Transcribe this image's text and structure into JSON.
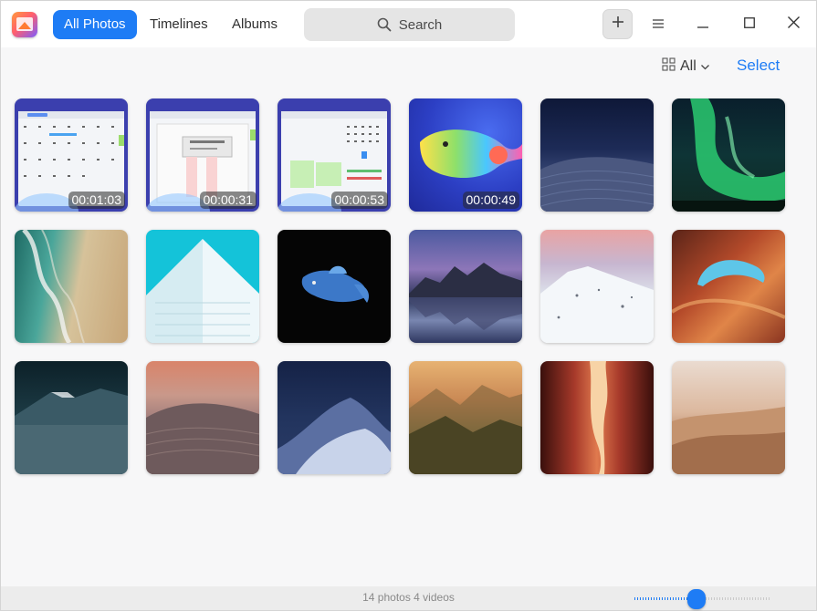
{
  "nav": {
    "tabs": [
      {
        "label": "All Photos",
        "active": true
      },
      {
        "label": "Timelines",
        "active": false
      },
      {
        "label": "Albums",
        "active": false
      }
    ]
  },
  "search": {
    "placeholder": "Search"
  },
  "toolbar": {
    "filter_label": "All",
    "select_label": "Select"
  },
  "photos": [
    {
      "kind": "video",
      "duration": "00:01:03",
      "subject": "calendar-month-screenshot"
    },
    {
      "kind": "video",
      "duration": "00:00:31",
      "subject": "calendar-dialog-screenshot"
    },
    {
      "kind": "video",
      "duration": "00:00:53",
      "subject": "calendar-day-screenshot"
    },
    {
      "kind": "video",
      "duration": "00:00:49",
      "subject": "rainbow-whale"
    },
    {
      "kind": "photo",
      "subject": "desert-dunes-night"
    },
    {
      "kind": "photo",
      "subject": "green-aurora"
    },
    {
      "kind": "photo",
      "subject": "aerial-beach-waves"
    },
    {
      "kind": "photo",
      "subject": "white-building-cyan-sky"
    },
    {
      "kind": "photo",
      "subject": "blue-betta-fish"
    },
    {
      "kind": "photo",
      "subject": "mountain-lake-reflection"
    },
    {
      "kind": "photo",
      "subject": "snowy-mountain-sunset"
    },
    {
      "kind": "photo",
      "subject": "red-sandstone-arch"
    },
    {
      "kind": "photo",
      "subject": "misty-mountain-peak"
    },
    {
      "kind": "photo",
      "subject": "sand-dune-sunset"
    },
    {
      "kind": "photo",
      "subject": "moonlit-sand-dunes"
    },
    {
      "kind": "photo",
      "subject": "golden-mountain-valley"
    },
    {
      "kind": "photo",
      "subject": "slot-canyon"
    },
    {
      "kind": "photo",
      "subject": "hazy-desert-dunes"
    }
  ],
  "status": {
    "summary": "14 photos 4 videos",
    "zoom_level": 0.45
  },
  "colors": {
    "accent": "#1e7cf5"
  }
}
